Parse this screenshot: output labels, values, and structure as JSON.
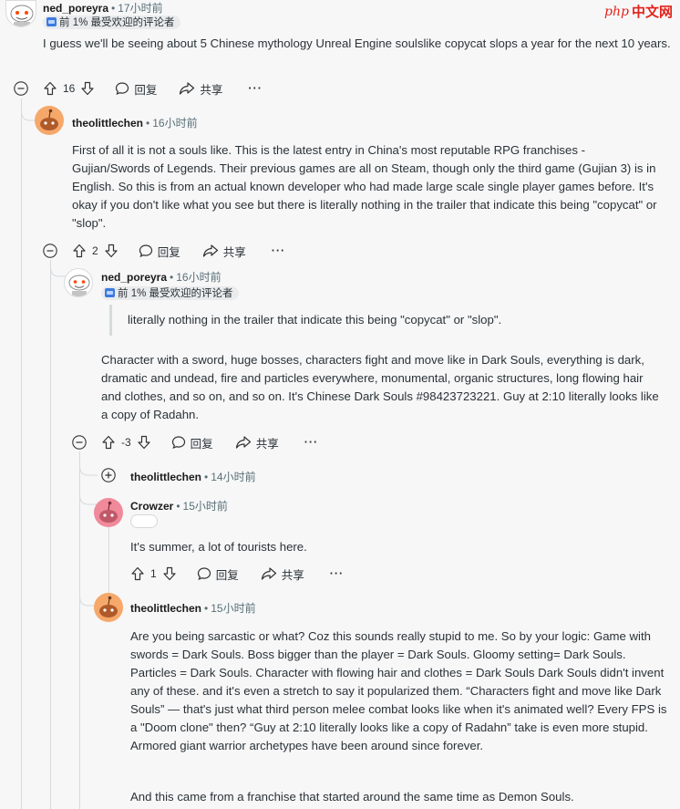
{
  "watermark": {
    "brand": "php",
    "site": "中文网"
  },
  "actions": {
    "reply": "回复",
    "share": "共享",
    "more": "···"
  },
  "comments": [
    {
      "user": "ned_poreyra",
      "time": "17小时前",
      "badge": "前 1% 最受欢迎的评论者",
      "text": "I guess we'll be seeing about 5 Chinese mythology Unreal Engine soulslike copycat slops a year for the next 10 years.",
      "score": "16"
    },
    {
      "user": "theolittlechen",
      "time": "16小时前",
      "text": "First of all it is not a souls like. This is the latest entry in China's most reputable RPG franchises - Gujian/Swords of Legends. Their previous games are all on Steam, though only the third game (Gujian 3) is in English. So this is from an actual known developer who had made large scale single player games before. It's okay if you don't like what you see but there is literally nothing in the trailer that indicate this being \"copycat\" or \"slop\".",
      "score": "2"
    },
    {
      "user": "ned_poreyra",
      "time": "16小时前",
      "badge": "前 1% 最受欢迎的评论者",
      "quote": "literally nothing in the trailer that indicate this being \"copycat\" or \"slop\".",
      "text": "Character with a sword, huge bosses, characters fight and move like in Dark Souls, everything is dark, dramatic and undead, fire and particles everywhere, monumental, organic structures, long flowing hair and clothes, and so on, and so on. It's Chinese Dark Souls #98423723221. Guy at 2:10 literally looks like a copy of Radahn.",
      "score": "-3"
    },
    {
      "user": "theolittlechen",
      "time": "14小时前",
      "collapsed": true
    },
    {
      "user": "Crowzer",
      "time": "15小时前",
      "text": "It's summer, a lot of tourists here.",
      "score": "1"
    },
    {
      "user": "theolittlechen",
      "time": "15小时前",
      "text": "Are you being sarcastic or what? Coz this sounds really stupid to me. So by your logic: Game with swords = Dark Souls. Boss bigger than the player = Dark Souls. Gloomy setting= Dark Souls. Particles = Dark Souls. Character with flowing hair and clothes = Dark Souls Dark Souls didn't invent any of these. and it's even a stretch to say it popularized them. “Characters fight and move like Dark Souls” — that's just what third person melee combat looks like when it's animated well? Every FPS is a \"Doom clone\" then? “Guy at 2:10 literally looks like a copy of Radahn” take is even more stupid. Armored giant warrior archetypes have been around since forever.",
      "text2": "And this came from a franchise that started around the same time as Demon Souls."
    }
  ]
}
